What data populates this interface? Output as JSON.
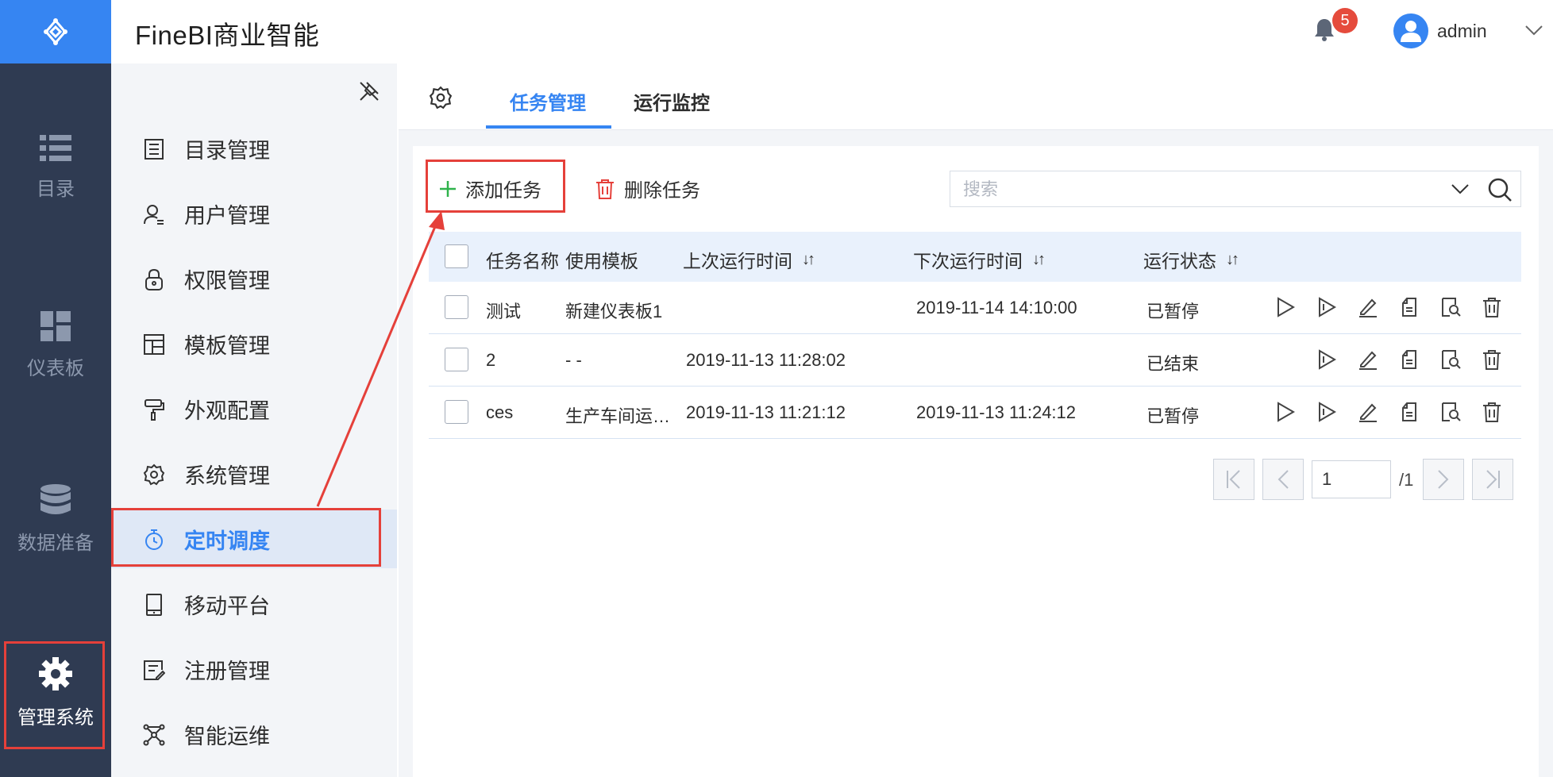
{
  "app": {
    "title": "FineBI商业智能"
  },
  "header": {
    "notification_count": "5",
    "username": "admin"
  },
  "rail": {
    "items": [
      {
        "label": "目录",
        "icon": "list-icon"
      },
      {
        "label": "仪表板",
        "icon": "dashboard-icon"
      },
      {
        "label": "数据准备",
        "icon": "database-icon"
      },
      {
        "label": "管理系统",
        "icon": "gear-icon",
        "active": true
      }
    ]
  },
  "submenu": {
    "items": [
      {
        "label": "目录管理",
        "icon": "catalog-icon"
      },
      {
        "label": "用户管理",
        "icon": "user-icon"
      },
      {
        "label": "权限管理",
        "icon": "lock-icon"
      },
      {
        "label": "模板管理",
        "icon": "template-icon"
      },
      {
        "label": "外观配置",
        "icon": "paint-roller-icon"
      },
      {
        "label": "系统管理",
        "icon": "gear-icon"
      },
      {
        "label": "定时调度",
        "icon": "timer-icon",
        "active": true
      },
      {
        "label": "移动平台",
        "icon": "tablet-icon"
      },
      {
        "label": "注册管理",
        "icon": "register-icon"
      },
      {
        "label": "智能运维",
        "icon": "network-icon"
      }
    ]
  },
  "tabs": [
    {
      "label": "任务管理",
      "active": true
    },
    {
      "label": "运行监控",
      "active": false
    }
  ],
  "toolbar": {
    "add_label": "添加任务",
    "delete_label": "删除任务",
    "search_placeholder": "搜索"
  },
  "table": {
    "headers": {
      "name": "任务名称",
      "template": "使用模板",
      "last_run": "上次运行时间",
      "next_run": "下次运行时间",
      "status": "运行状态"
    },
    "rows": [
      {
        "name": "测试",
        "template": "新建仪表板1",
        "last_run": "",
        "next_run": "2019-11-14 14:10:00",
        "status": "已暂停"
      },
      {
        "name": "2",
        "template": "- -",
        "last_run": "2019-11-13 11:28:02",
        "next_run": "",
        "status": "已结束"
      },
      {
        "name": "ces",
        "template": "生产车间运…",
        "last_run": "2019-11-13 11:21:12",
        "next_run": "2019-11-13 11:24:12",
        "status": "已暂停"
      }
    ]
  },
  "pagination": {
    "current": "1",
    "total": "/1"
  },
  "colors": {
    "primary": "#3685f2",
    "rail": "#2f3b52",
    "annotation": "#e5403a",
    "badge": "#e54b3c"
  }
}
